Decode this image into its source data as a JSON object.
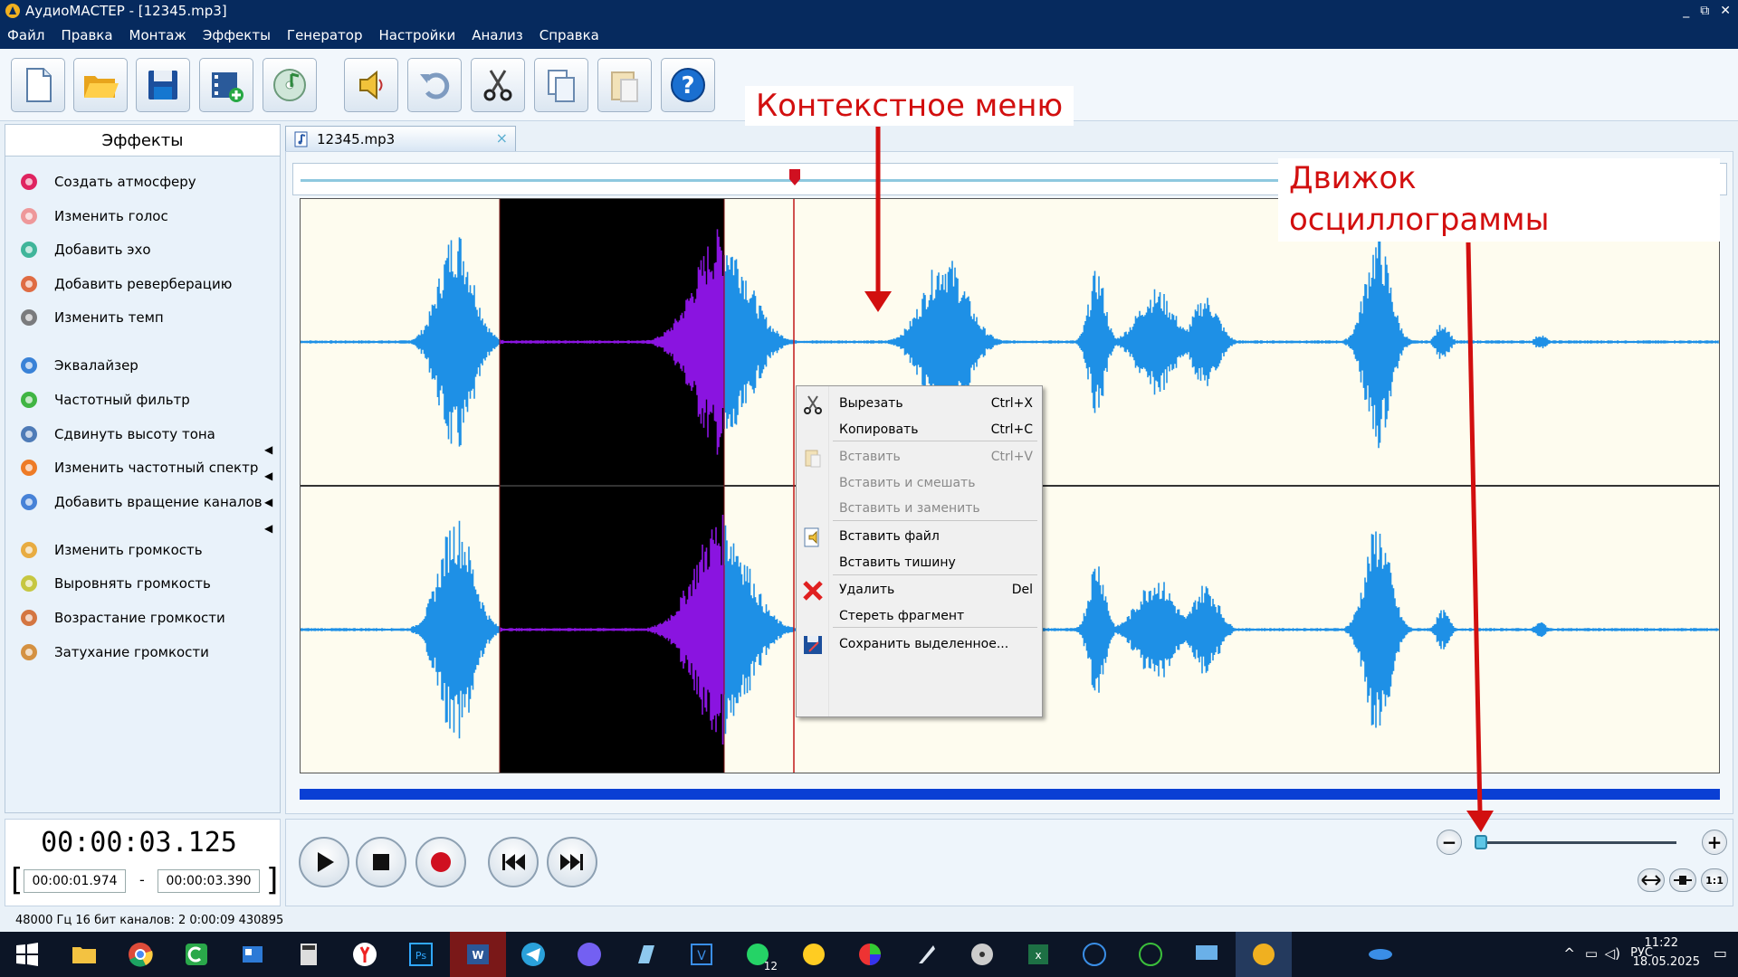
{
  "window": {
    "title": "АудиоМАСТЕР - [12345.mp3]",
    "controls": [
      "_",
      "⧉",
      "✕"
    ]
  },
  "menu": [
    "Файл",
    "Правка",
    "Монтаж",
    "Эффекты",
    "Генератор",
    "Настройки",
    "Анализ",
    "Справка"
  ],
  "effects": {
    "header": "Эффекты",
    "items": [
      {
        "label": "Создать атмосферу",
        "icon": "atmosphere-icon"
      },
      {
        "label": "Изменить голос",
        "icon": "voice-icon"
      },
      {
        "label": "Добавить эхо",
        "icon": "echo-icon"
      },
      {
        "label": "Добавить реверберацию",
        "icon": "reverb-icon"
      },
      {
        "label": "Изменить темп",
        "icon": "tempo-icon"
      },
      {
        "label": "Эквалайзер",
        "icon": "equalizer-icon"
      },
      {
        "label": "Частотный фильтр",
        "icon": "filter-icon"
      },
      {
        "label": "Сдвинуть высоту тона",
        "icon": "pitch-icon"
      },
      {
        "label": "Изменить частотный спектр",
        "icon": "spectrum-icon"
      },
      {
        "label": "Добавить вращение каналов",
        "icon": "rotate-channels-icon"
      },
      {
        "label": "Изменить громкость",
        "icon": "volume-icon"
      },
      {
        "label": "Выровнять громкость",
        "icon": "normalize-icon"
      },
      {
        "label": "Возрастание громкости",
        "icon": "fade-in-icon"
      },
      {
        "label": "Затухание громкости",
        "icon": "fade-out-icon"
      }
    ]
  },
  "tab": {
    "name": "12345.mp3",
    "close": "×"
  },
  "context_menu": [
    {
      "label": "Вырезать",
      "shortcut": "Ctrl+X",
      "enabled": true,
      "icon": "scissors-icon"
    },
    {
      "label": "Копировать",
      "shortcut": "Ctrl+C",
      "enabled": true
    },
    {
      "label": "Вставить",
      "shortcut": "Ctrl+V",
      "enabled": false,
      "icon": "paste-icon"
    },
    {
      "label": "Вставить и смешать",
      "shortcut": "",
      "enabled": false
    },
    {
      "label": "Вставить и заменить",
      "shortcut": "",
      "enabled": false
    },
    {
      "label": "Вставить файл",
      "shortcut": "",
      "enabled": true,
      "icon": "insert-file-icon"
    },
    {
      "label": "Вставить тишину",
      "shortcut": "",
      "enabled": true
    },
    {
      "label": "Удалить",
      "shortcut": "Del",
      "enabled": true,
      "icon": "delete-icon"
    },
    {
      "label": "Стереть фрагмент",
      "shortcut": "",
      "enabled": true
    },
    {
      "label": "Сохранить выделенное...",
      "shortcut": "",
      "enabled": true,
      "icon": "save-selection-icon"
    }
  ],
  "annotations": {
    "context_menu": "Контекстное меню",
    "zoom_line1": "Движок масштабирования",
    "zoom_line2": "осциллограммы"
  },
  "time": {
    "current": "00:00:03.125",
    "start": "00:00:01.974",
    "end": "00:00:03.390",
    "dash": "-",
    "bracket_open": "[",
    "bracket_close": "]"
  },
  "status": "48000 Гц  16 бит  каналов: 2   0:00:09 430895",
  "zoom": {
    "minus": "−",
    "plus": "+",
    "fit": "1:1"
  },
  "taskbar": {
    "lang": "РУС",
    "time": "11:22",
    "date": "18.05.2025",
    "whatsapp_badge": "12"
  },
  "colors": {
    "waveform": "#1e90e6",
    "selection": "#8a14e0",
    "accent": "#062a5e",
    "annotation": "#d20f0f"
  }
}
